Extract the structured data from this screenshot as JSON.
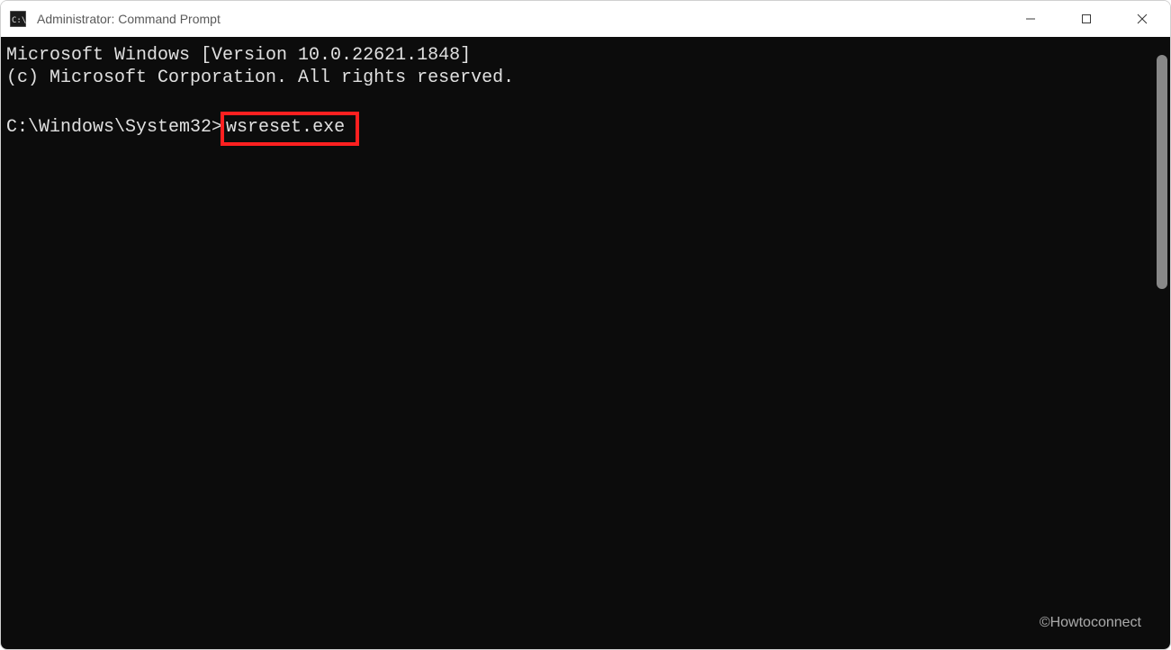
{
  "window": {
    "title": "Administrator: Command Prompt"
  },
  "terminal": {
    "line1": "Microsoft Windows [Version 10.0.22621.1848]",
    "line2": "(c) Microsoft Corporation. All rights reserved.",
    "prompt": "C:\\Windows\\System32>",
    "command": "wsreset.exe"
  },
  "watermark": "©Howtoconnect"
}
